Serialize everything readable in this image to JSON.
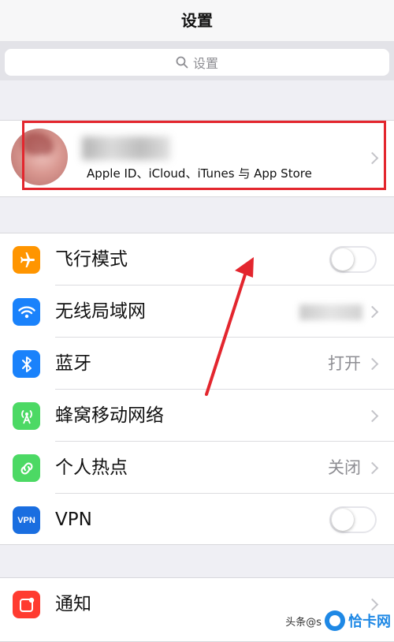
{
  "nav": {
    "title": "设置"
  },
  "search": {
    "placeholder": "设置"
  },
  "profile": {
    "subtitle": "Apple ID、iCloud、iTunes 与 App Store"
  },
  "settings": [
    {
      "id": "airplane",
      "label": "飞行模式",
      "icon": "airplane-icon",
      "color": "#ff9500",
      "control": "toggle",
      "on": false
    },
    {
      "id": "wifi",
      "label": "无线局域网",
      "icon": "wifi-icon",
      "color": "#1a82fb",
      "control": "value",
      "value": ""
    },
    {
      "id": "bluetooth",
      "label": "蓝牙",
      "icon": "bluetooth-icon",
      "color": "#1a82fb",
      "control": "value",
      "value": "打开"
    },
    {
      "id": "cellular",
      "label": "蜂窝移动网络",
      "icon": "cellular-icon",
      "color": "#4cd964",
      "control": "chevron"
    },
    {
      "id": "hotspot",
      "label": "个人热点",
      "icon": "hotspot-icon",
      "color": "#4cd964",
      "control": "value",
      "value": "关闭"
    },
    {
      "id": "vpn",
      "label": "VPN",
      "icon": "vpn-icon",
      "icon_text": "VPN",
      "color": "#1a6ee0",
      "control": "toggle",
      "on": false
    }
  ],
  "notifications": {
    "label": "通知",
    "icon": "notifications-icon",
    "color": "#ff3b30"
  },
  "watermark": {
    "source_text": "头条@s",
    "brand": "恰卡网"
  }
}
